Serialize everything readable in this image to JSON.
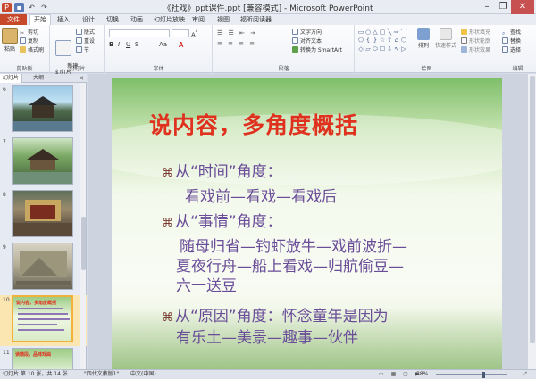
{
  "window": {
    "title": "《社戏》ppt课件.ppt [兼容模式] - Microsoft PowerPoint",
    "controls": [
      "–",
      "❐",
      "✕"
    ]
  },
  "tabs": [
    "文件",
    "开始",
    "插入",
    "设计",
    "切换",
    "动画",
    "幻灯片放映",
    "审阅",
    "视图",
    "福昕阅读器"
  ],
  "ribbon": {
    "clipboard": {
      "paste": "粘贴",
      "cut": "剪切",
      "copy": "复制",
      "format_painter": "格式刷",
      "label": "剪贴板"
    },
    "slides": {
      "new_slide": "新建\n幻灯片",
      "layout": "版式",
      "reset": "重设",
      "section": "节",
      "label": "幻灯片"
    },
    "font": {
      "label": "字体",
      "bold": "B",
      "italic": "I",
      "underline": "U",
      "strike": "S",
      "aa": "Aa"
    },
    "paragraph": {
      "text_direction": "文字方向",
      "align_text": "对齐文本",
      "smartart": "转换为 SmartArt",
      "label": "段落"
    },
    "drawing": {
      "arrange": "排列",
      "quick_styles": "快速样式",
      "shape_fill": "形状填充",
      "shape_outline": "形状轮廓",
      "shape_effects": "形状效果",
      "label": "绘图"
    },
    "editing": {
      "find": "查找",
      "replace": "替换",
      "select": "选择",
      "label": "编辑"
    }
  },
  "pane": {
    "tab_slides": "幻灯片",
    "tab_outline": "大纲",
    "thumbs": [
      {
        "num": "6"
      },
      {
        "num": "7"
      },
      {
        "num": "8"
      },
      {
        "num": "9"
      },
      {
        "num": "10",
        "title": "说内容，多角度概括"
      },
      {
        "num": "11",
        "title": "读精段，品味戏曲"
      }
    ]
  },
  "slide": {
    "title": "说内容，多角度概括",
    "bullets": [
      {
        "text": "从“时间”角度：",
        "sub": [
          "看戏前—看戏—看戏后"
        ]
      },
      {
        "text": "从“事情”角度：",
        "sub": [
          "随母归省—钓虾放牛—戏前波折—",
          "夏夜行舟—船上看戏—归航偷豆—",
          "六一送豆"
        ]
      },
      {
        "text": "从“原因”角度：怀念童年是因为",
        "sub": [
          "有乐土—美景—趣事—伙伴"
        ]
      }
    ],
    "bullet_glyph": "⌘"
  },
  "status": {
    "slide_info": "幻灯片 第 10 张，共 14 张",
    "theme": "\"四代文教版1\"",
    "language": "中文(中国)",
    "zoom": "88%"
  }
}
